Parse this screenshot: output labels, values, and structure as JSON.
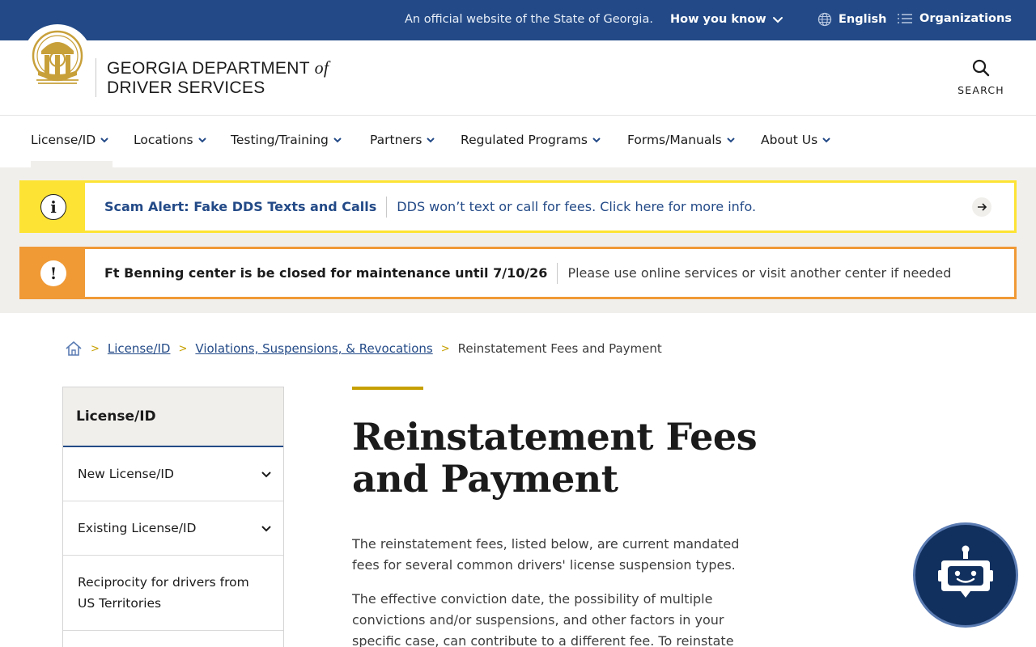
{
  "gov_banner": {
    "official_text": "An official website of the State of Georgia.",
    "how_you_know": "How you know",
    "language": "English",
    "organizations": "Organizations"
  },
  "header": {
    "brand_line1": "GEORGIA DEPARTMENT",
    "brand_of": "of",
    "brand_line2": "DRIVER SERVICES",
    "search_label": "SEARCH"
  },
  "nav": {
    "items": [
      {
        "label": "License/ID"
      },
      {
        "label": "Locations"
      },
      {
        "label": "Testing/Training"
      },
      {
        "label": "Partners"
      },
      {
        "label": "Regulated Programs"
      },
      {
        "label": "Forms/Manuals"
      },
      {
        "label": "About Us"
      }
    ]
  },
  "alerts": {
    "scam": {
      "icon": "i",
      "title": "Scam Alert: Fake DDS Texts and Calls",
      "message": "DDS won’t text or call for fees. Click here for more info."
    },
    "closure": {
      "icon": "!",
      "title": "Ft Benning center is be closed for maintenance until 7/10/26",
      "message": "Please use online services or visit another center if needed"
    }
  },
  "breadcrumb": {
    "items": [
      "License/ID",
      "Violations, Suspensions, & Revocations"
    ],
    "current": "Reinstatement Fees and Payment"
  },
  "sidebar": {
    "heading": "License/ID",
    "items": [
      {
        "label": "New License/ID"
      },
      {
        "label": "Existing License/ID"
      },
      {
        "label": "Reciprocity for drivers from US Territories"
      }
    ]
  },
  "main": {
    "title": "Reinstatement Fees and Payment",
    "paragraph1": "The reinstatement fees, listed below, are current mandated fees for several common drivers' license suspension types.",
    "paragraph2": "The effective conviction date, the possibility of multiple convictions and/or suspensions, and other factors in your specific case, can contribute to a different fee.  To reinstate"
  },
  "colors": {
    "gov_bar": "#234a87",
    "accent_gold": "#c6a000",
    "scam_yellow": "#fde334",
    "closure_orange": "#f09a36",
    "chatbot_navy": "#12305e"
  }
}
